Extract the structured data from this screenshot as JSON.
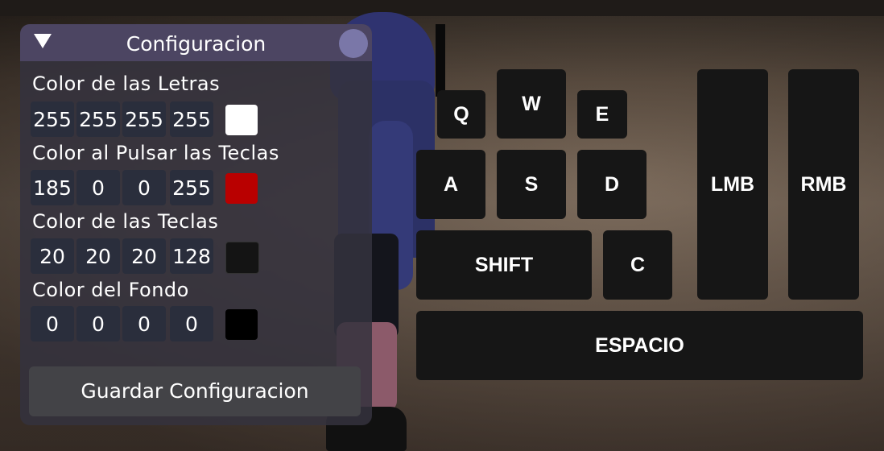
{
  "panel": {
    "title": "Configuracion",
    "sections": [
      {
        "label": "Color de las Letras",
        "values": [
          "255",
          "255",
          "255",
          "255"
        ],
        "swatch": "#ffffff"
      },
      {
        "label": "Color al Pulsar las Teclas",
        "values": [
          "185",
          "0",
          "0",
          "255"
        ],
        "swatch": "#b90000"
      },
      {
        "label": "Color de las Teclas",
        "values": [
          "20",
          "20",
          "20",
          "128"
        ],
        "swatch": "#141414"
      },
      {
        "label": "Color del Fondo",
        "values": [
          "0",
          "0",
          "0",
          "0"
        ],
        "swatch": "#000000"
      }
    ],
    "save_label": "Guardar Configuracion"
  },
  "keys": {
    "q": "Q",
    "w": "W",
    "e": "E",
    "a": "A",
    "s": "S",
    "d": "D",
    "shift": "SHIFT",
    "c": "C",
    "lmb": "LMB",
    "rmb": "RMB",
    "space": "ESPACIO"
  }
}
